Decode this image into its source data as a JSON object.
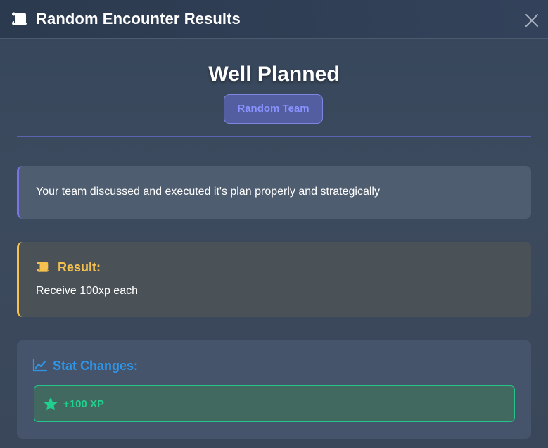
{
  "header": {
    "title": "Random Encounter Results",
    "icon": "scroll-icon",
    "close_icon": "close-icon"
  },
  "encounter": {
    "title": "Well Planned",
    "badge": "Random Team"
  },
  "description": {
    "text": "Your team discussed and executed it's plan properly and strategically"
  },
  "result": {
    "icon": "scroll-icon",
    "label": "Result:",
    "text": "Receive 100xp each"
  },
  "stat_changes": {
    "icon": "chart-line-icon",
    "label": "Stat Changes:",
    "items": [
      {
        "icon": "star-icon",
        "text": "+100 XP"
      }
    ]
  },
  "colors": {
    "accent_purple": "#7a72e6",
    "accent_gold": "#f6c24f",
    "accent_blue": "#2f95e8",
    "accent_green": "#1fd08e"
  }
}
